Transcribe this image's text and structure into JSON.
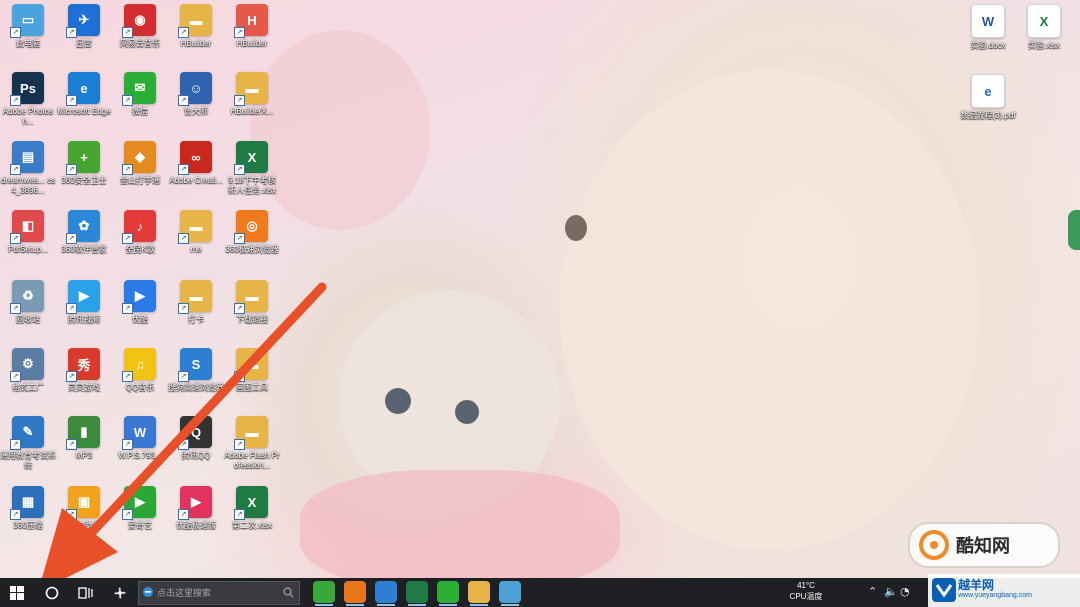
{
  "desktop_icons_left": [
    {
      "label": "此电脑",
      "color": "#4aa3df",
      "glyph": "▭"
    },
    {
      "label": "迅雷",
      "color": "#1e6fd6",
      "glyph": "✈"
    },
    {
      "label": "网易云音乐",
      "color": "#d42d2d",
      "glyph": "◉"
    },
    {
      "label": "HBuilder",
      "color": "#e6b447",
      "glyph": "▬"
    },
    {
      "label": "HBuilder",
      "color": "#e5584a",
      "glyph": "H"
    },
    {
      "label": "Adobe Photosh...",
      "color": "#15324f",
      "glyph": "Ps"
    },
    {
      "label": "Microsoft Edge",
      "color": "#1b7fd6",
      "glyph": "e"
    },
    {
      "label": "微信",
      "color": "#2aae35",
      "glyph": "✉"
    },
    {
      "label": "鲁大师",
      "color": "#2f63b0",
      "glyph": "☺"
    },
    {
      "label": "HBuilderX...",
      "color": "#e6b447",
      "glyph": "▬"
    },
    {
      "label": "dreamwea... cs4_3896...",
      "color": "#3a7cc7",
      "glyph": "▤"
    },
    {
      "label": "360安全卫士",
      "color": "#46a530",
      "glyph": "+"
    },
    {
      "label": "金山打字通",
      "color": "#e58a1f",
      "glyph": "◆"
    },
    {
      "label": "Adobe Creati...",
      "color": "#c8281e",
      "glyph": "∞"
    },
    {
      "label": "9.18下午考核 新人任务.xlsx",
      "color": "#1f7a43",
      "glyph": "X"
    },
    {
      "label": "PdfSetup...",
      "color": "#e04a4a",
      "glyph": "◧"
    },
    {
      "label": "360软件管家",
      "color": "#2b88d8",
      "glyph": "✿"
    },
    {
      "label": "全民K歌",
      "color": "#e33a3a",
      "glyph": "♪"
    },
    {
      "label": "me",
      "color": "#e6b447",
      "glyph": "▬"
    },
    {
      "label": "360极速浏览器",
      "color": "#f07b1c",
      "glyph": "◎"
    },
    {
      "label": "回收站",
      "color": "#7a9bb3",
      "glyph": "♻"
    },
    {
      "label": "腾讯视频",
      "color": "#2aa1e8",
      "glyph": "▶"
    },
    {
      "label": "优酷",
      "color": "#2c7ae6",
      "glyph": "▶"
    },
    {
      "label": "打卡",
      "color": "#e6b447",
      "glyph": "▬"
    },
    {
      "label": "下载链接",
      "color": "#e6b447",
      "glyph": "▬"
    },
    {
      "label": "格式工厂",
      "color": "#5b7ca3",
      "glyph": "⚙"
    },
    {
      "label": "灵灵游戏",
      "color": "#d93a2b",
      "glyph": "秀"
    },
    {
      "label": "QQ音乐",
      "color": "#f2c311",
      "glyph": "♫"
    },
    {
      "label": "搜狗高速浏览器",
      "color": "#2d7fd3",
      "glyph": "S"
    },
    {
      "label": "画图工具",
      "color": "#e6b447",
      "glyph": "▬"
    },
    {
      "label": "通用教育考试系统",
      "color": "#2f78c4",
      "glyph": "✎"
    },
    {
      "label": "MP3",
      "color": "#3c8b3c",
      "glyph": "▮"
    },
    {
      "label": "W.P.S.793...",
      "color": "#3b78d4",
      "glyph": "W"
    },
    {
      "label": "腾讯QQ",
      "color": "#333333",
      "glyph": "Q"
    },
    {
      "label": "Adobe Flash Profession...",
      "color": "#e6b447",
      "glyph": "▬"
    },
    {
      "label": "360压缩",
      "color": "#2e6fbc",
      "glyph": "▦"
    },
    {
      "label": "我的助手",
      "color": "#f2a31b",
      "glyph": "▣"
    },
    {
      "label": "爱奇艺",
      "color": "#2aa836",
      "glyph": "▶"
    },
    {
      "label": "优酷极速版",
      "color": "#e3325d",
      "glyph": "▶"
    },
    {
      "label": "第二次.xlsx",
      "color": "#1f7a43",
      "glyph": "X"
    }
  ],
  "desktop_icons_right": [
    {
      "label": "实验.docx",
      "color": "#2b579a",
      "glyph": "W"
    },
    {
      "label": "实验.xlsx",
      "color": "#1f7a43",
      "glyph": "X"
    },
    {
      "label": "数据流程(3).pdf",
      "color": "#2a6ec9",
      "glyph": "e"
    }
  ],
  "taskbar": {
    "search_placeholder": "点击这里搜索",
    "cpu_temp": "41°C",
    "cpu_label": "CPU温度",
    "apps": [
      {
        "name": "360安全卫士",
        "color": "#39a83a"
      },
      {
        "name": "360极速浏览器",
        "color": "#e8771a"
      },
      {
        "name": "搜狗高速浏览器",
        "color": "#2d7fd3"
      },
      {
        "name": "Excel",
        "color": "#1f7a43"
      },
      {
        "name": "微信",
        "color": "#2aae35"
      },
      {
        "name": "文件资源管理器",
        "color": "#e6b447"
      },
      {
        "name": "远程桌面",
        "color": "#4ea0d8"
      }
    ]
  },
  "watermarks": {
    "main": "酷知网",
    "secondary_big": "越羊网",
    "secondary_small": "www.yueyangbang.com"
  }
}
